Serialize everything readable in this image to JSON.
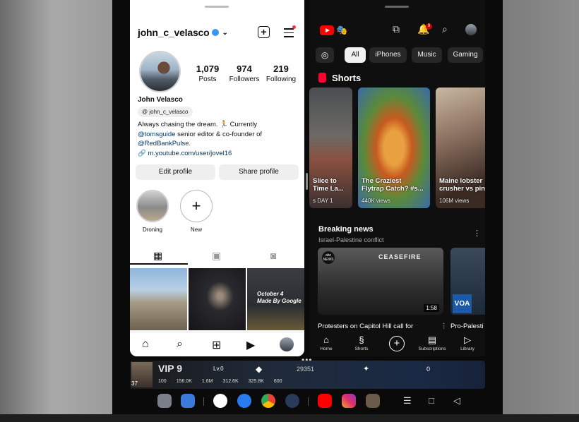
{
  "instagram": {
    "username": "john_c_velasco",
    "stats": [
      {
        "num": "1,079",
        "label": "Posts"
      },
      {
        "num": "974",
        "label": "Followers"
      },
      {
        "num": "219",
        "label": "Following"
      }
    ],
    "display_name": "John Velasco",
    "threads_handle": "john_c_velasco",
    "bio_line1": "Always chasing the dream. 🏃 Currently",
    "bio_mention1": "@tomsguide",
    "bio_line2": " senior editor & co-founder of",
    "bio_mention2": "@RedBankPulse",
    "bio_period": ".",
    "bio_link": "m.youtube.com/user/jovel16",
    "edit_profile": "Edit profile",
    "share_profile": "Share profile",
    "stories": [
      {
        "label": "Droning"
      },
      {
        "label": "New"
      }
    ],
    "grid_overlay_text": "October 4\nMade By Google"
  },
  "youtube": {
    "notification_count": "9",
    "chips": [
      "All",
      "iPhones",
      "Music",
      "Gaming"
    ],
    "shorts_header": "Shorts",
    "shorts": [
      {
        "title": "Slice to\nTime La...",
        "views": "s   DAY 1"
      },
      {
        "title": "The Craziest\nFlytrap Catch? #s...",
        "views": "440K views"
      },
      {
        "title": "Maine lobster\ncrusher vs pin",
        "views": "106M views"
      }
    ],
    "breaking_title": "Breaking news",
    "breaking_sub": "Israel-Palestine conflict",
    "news": [
      {
        "caption": "Protesters on Capitol Hill call for",
        "duration": "1:58",
        "overlay": "CEASEFIRE",
        "logo": "abc NEWS"
      },
      {
        "caption": "Pro-Palesti",
        "logo": "VOA"
      }
    ],
    "nav": [
      {
        "label": "Home"
      },
      {
        "label": "Shorts"
      },
      {
        "label": ""
      },
      {
        "label": "Subscriptions"
      },
      {
        "label": "Library"
      }
    ]
  },
  "game": {
    "vip": "VIP 9",
    "level_tag": "Lv.0",
    "player_level": "37",
    "score": "29351",
    "zero": "0",
    "stats": [
      "100",
      "156.0K",
      "1.6M",
      "312.6K",
      "325.8K",
      "600"
    ]
  },
  "colors": {
    "yt_red": "#ff0000",
    "ig_blue": "#3897f0",
    "link": "#00376b"
  }
}
